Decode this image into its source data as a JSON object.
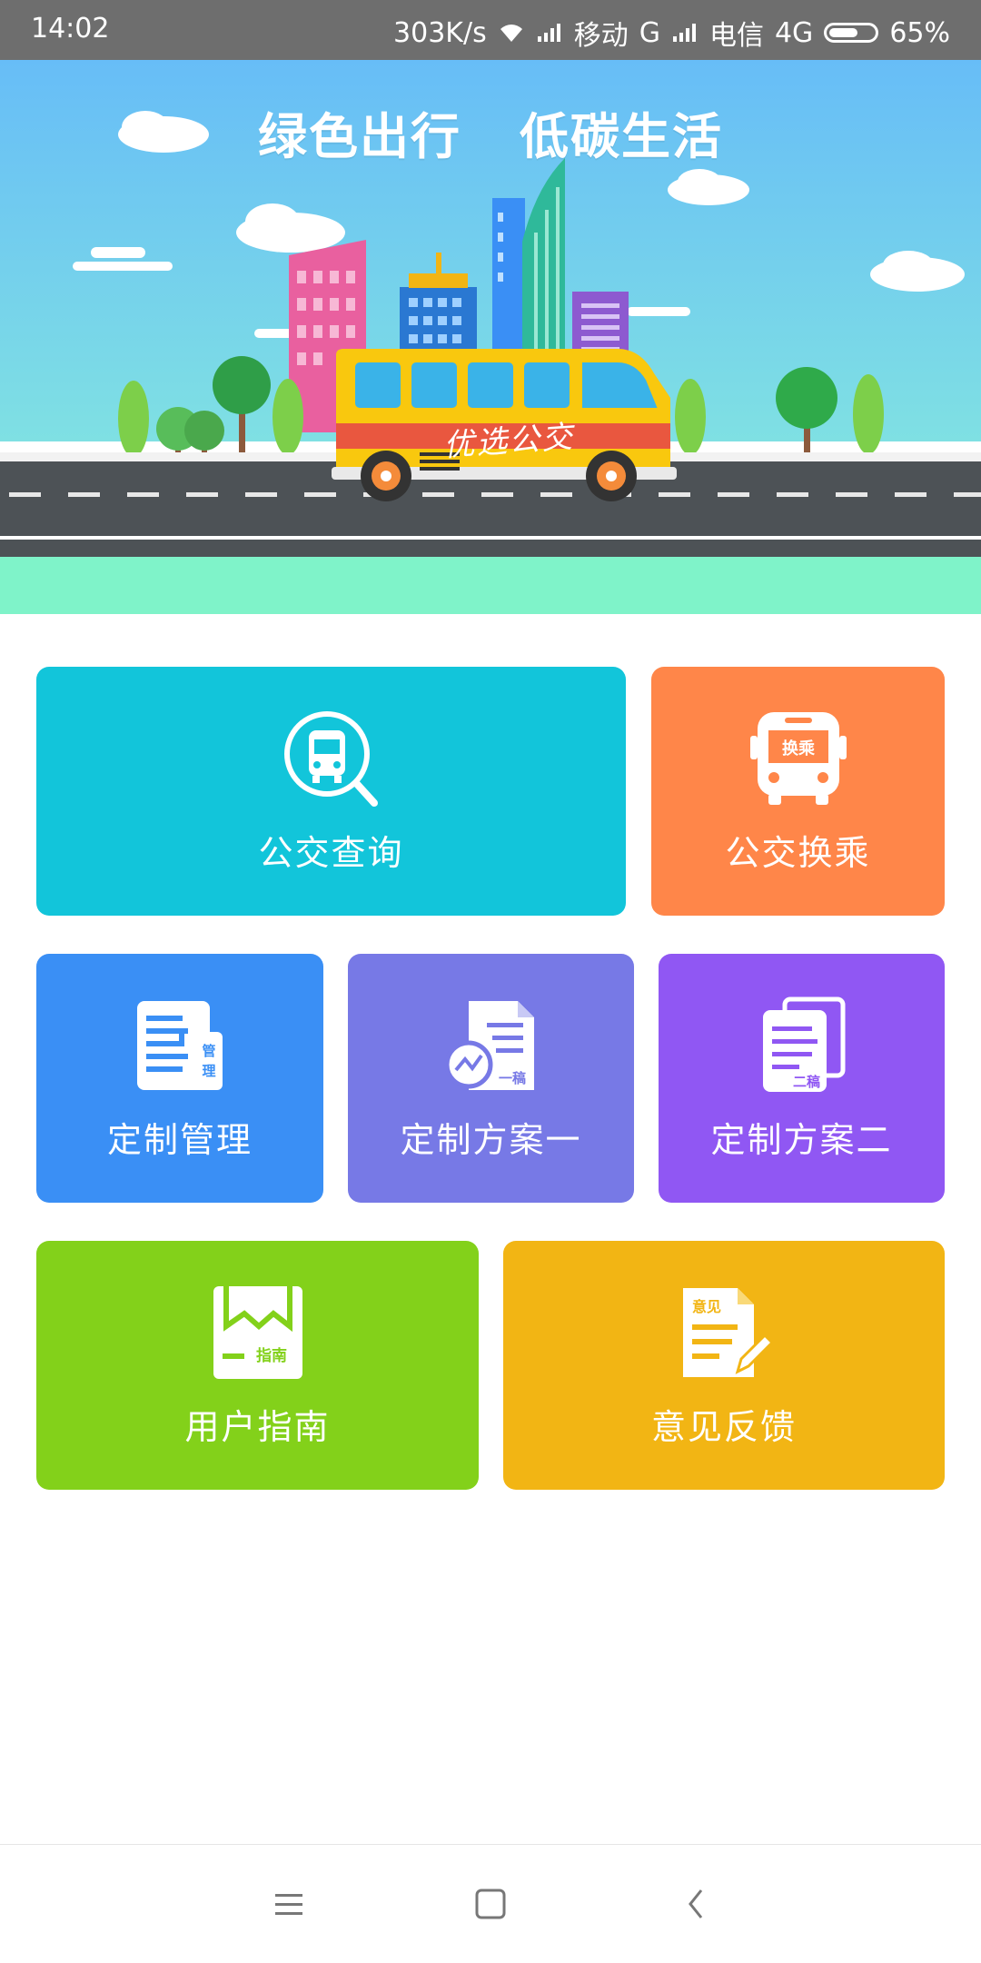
{
  "status_bar": {
    "time": "14:02",
    "speed": "303K/s",
    "carrier1": "移动",
    "net1": "G",
    "carrier2": "电信",
    "net2": "4G",
    "battery": "65%",
    "battery_level": 0.65
  },
  "banner": {
    "title_left": "绿色出行",
    "title_right": "低碳生活",
    "bus_label": "优选公交"
  },
  "tiles": [
    {
      "label": "公交查询",
      "icon": "bus-search-icon",
      "color": "#12c5da"
    },
    {
      "label": "公交换乘",
      "icon": "bus-transfer-icon",
      "color": "#ff8649",
      "icon_text": "换乘"
    },
    {
      "label": "定制管理",
      "icon": "manage-doc-icon",
      "color": "#3a8ff5",
      "icon_text": "管理"
    },
    {
      "label": "定制方案一",
      "icon": "plan-one-icon",
      "color": "#7779e6",
      "icon_text": "一稿"
    },
    {
      "label": "定制方案二",
      "icon": "plan-two-icon",
      "color": "#9057f3",
      "icon_text": "二稿"
    },
    {
      "label": "用户指南",
      "icon": "guide-book-icon",
      "color": "#83d11a",
      "icon_text": "指南"
    },
    {
      "label": "意见反馈",
      "icon": "feedback-icon",
      "color": "#f2b514",
      "icon_text": "意见"
    }
  ],
  "navbar": {
    "menu": "menu-icon",
    "home": "home-icon",
    "back": "back-icon"
  }
}
